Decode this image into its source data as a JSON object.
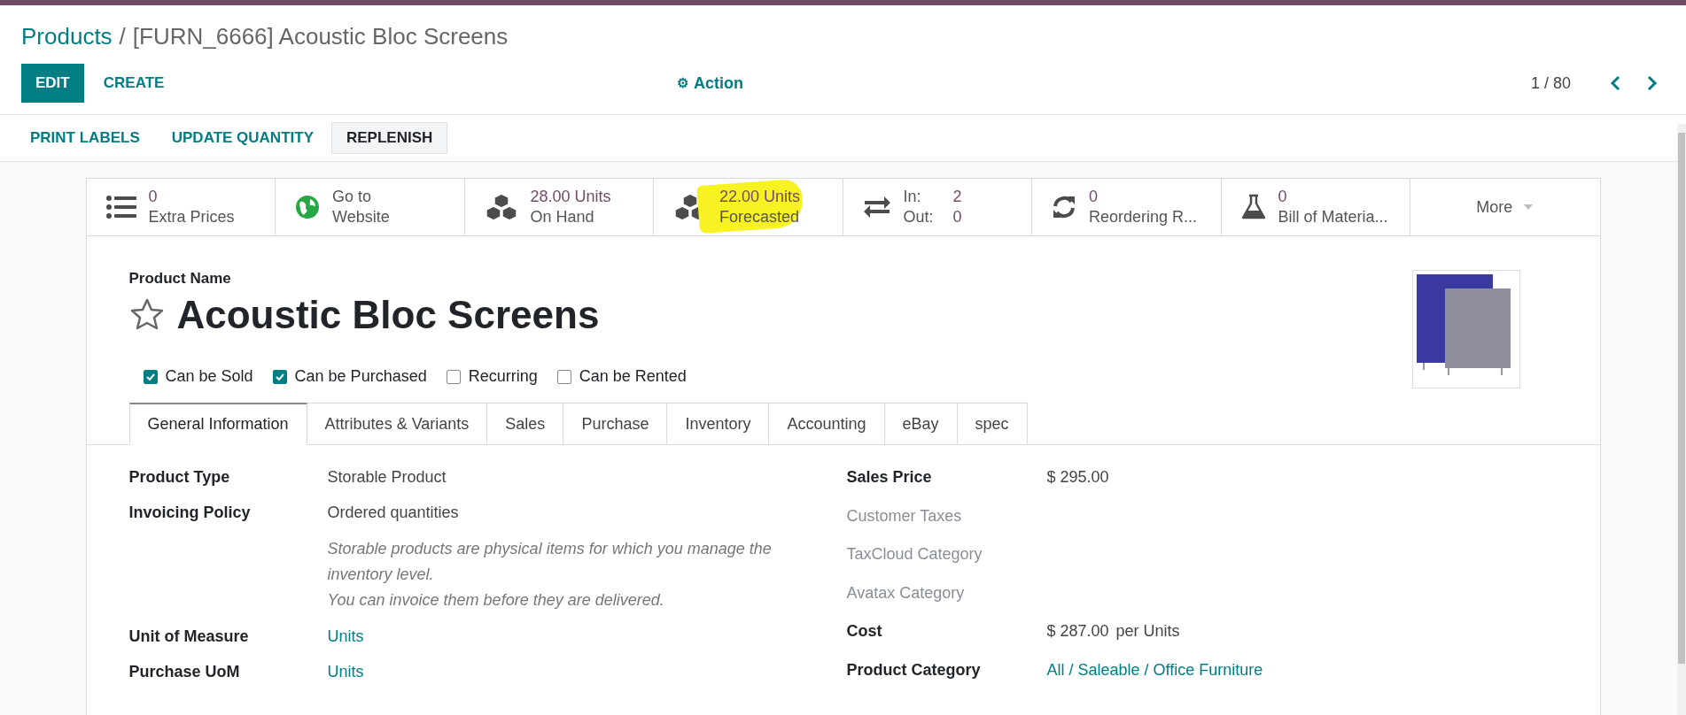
{
  "breadcrumb": {
    "parent": "Products",
    "separator": "/",
    "current": "[FURN_6666] Acoustic Bloc Screens"
  },
  "control_panel": {
    "buttons": [
      {
        "label": "EDIT",
        "kind": "primary"
      },
      {
        "label": "CREATE",
        "kind": "link"
      }
    ],
    "action": {
      "icon": "⚙",
      "label": "Action"
    },
    "pager": "1 / 80"
  },
  "toolbar": [
    {
      "label": "PRINT LABELS",
      "kind": "link"
    },
    {
      "label": "UPDATE QUANTITY",
      "kind": "link"
    },
    {
      "label": "REPLENISH",
      "kind": "secondary"
    }
  ],
  "stat_buttons": [
    {
      "kind": "list",
      "value": "0",
      "label": "Extra Prices",
      "plain": false
    },
    {
      "kind": "globe",
      "value": "Go to",
      "label": "Website",
      "plain": true
    },
    {
      "kind": "cubes",
      "value": "28.00 Units",
      "label": "On Hand",
      "plain": false
    },
    {
      "kind": "cubes",
      "value": "22.00 Units",
      "label": "Forecasted",
      "highlighted": true,
      "plain": false
    },
    {
      "kind": "inout",
      "in_label": "In:",
      "in_value": "2",
      "out_label": "Out:",
      "out_value": "0"
    },
    {
      "kind": "refresh",
      "value": "0",
      "label": "Reordering R...",
      "plain": false
    },
    {
      "kind": "flask",
      "value": "0",
      "label": "Bill of Materia...",
      "plain": false
    },
    {
      "kind": "more",
      "label": "More"
    }
  ],
  "product": {
    "name_label": "Product Name",
    "name": "Acoustic Bloc Screens",
    "favorite": false
  },
  "options": [
    {
      "label": "Can be Sold",
      "checked": true
    },
    {
      "label": "Can be Purchased",
      "checked": true
    },
    {
      "label": "Recurring",
      "checked": false
    },
    {
      "label": "Can be Rented",
      "checked": false
    }
  ],
  "tabs": [
    {
      "label": "General Information",
      "selected": true
    },
    {
      "label": "Attributes & Variants",
      "selected": false
    },
    {
      "label": "Sales",
      "selected": false
    },
    {
      "label": "Purchase",
      "selected": false
    },
    {
      "label": "Inventory",
      "selected": false
    },
    {
      "label": "Accounting",
      "selected": false
    },
    {
      "label": "eBay",
      "selected": false
    },
    {
      "label": "spec",
      "selected": false
    }
  ],
  "left_fields": [
    {
      "label": "Product Type",
      "value": "Storable Product",
      "kind": "text"
    },
    {
      "label": "Invoicing Policy",
      "value": "Ordered quantities",
      "kind": "text",
      "help": [
        "Storable products are physical items for which you manage the inventory level.",
        "You can invoice them before they are delivered."
      ]
    },
    {
      "label": "Unit of Measure",
      "value": "Units",
      "kind": "link"
    },
    {
      "label": "Purchase UoM",
      "value": "Units",
      "kind": "link"
    }
  ],
  "right_fields": [
    {
      "label": "Sales Price",
      "value": "$ 295.00",
      "kind": "text",
      "muted": false
    },
    {
      "label": "Customer Taxes",
      "muted": true
    },
    {
      "label": "TaxCloud Category",
      "muted": true
    },
    {
      "label": "Avatax Category",
      "muted": true
    },
    {
      "label": "Cost",
      "value": "$ 287.00",
      "suffix": "per Units",
      "kind": "text",
      "muted": false
    },
    {
      "label": "Product Category",
      "value": "All / Saleable / Office Furniture",
      "kind": "link",
      "muted": false
    }
  ]
}
